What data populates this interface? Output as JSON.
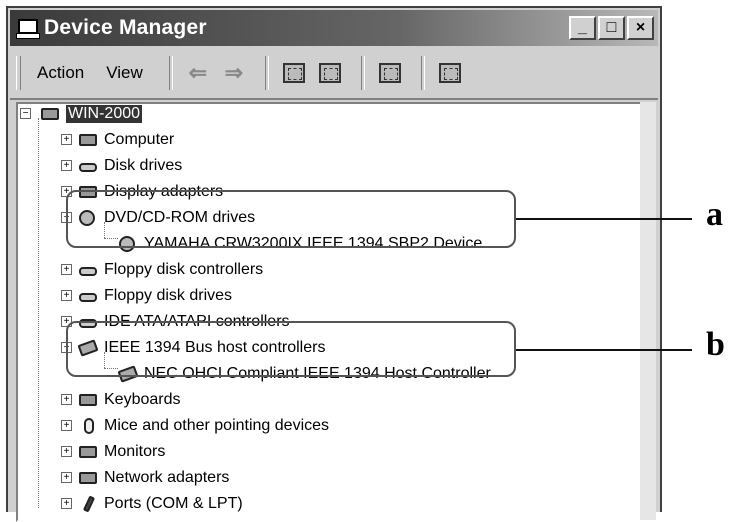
{
  "window": {
    "title": "Device Manager",
    "buttons": {
      "minimize": "_",
      "maximize": "□",
      "close": "×"
    }
  },
  "toolbar": {
    "menu_action": "Action",
    "menu_view": "View",
    "back_icon": "arrow-left-icon",
    "forward_icon": "arrow-right-icon"
  },
  "tree": {
    "root": "WIN-2000",
    "items": [
      {
        "label": "Computer",
        "icon": "computer-icon"
      },
      {
        "label": "Disk drives",
        "icon": "disk-drive-icon"
      },
      {
        "label": "Display adapters",
        "icon": "display-icon"
      },
      {
        "label": "DVD/CD-ROM drives",
        "icon": "dvd-icon",
        "child": "YAMAHA CRW3200IX IEEE 1394 SBP2 Device"
      },
      {
        "label": "Floppy disk controllers",
        "icon": "floppy-controller-icon"
      },
      {
        "label": "Floppy disk drives",
        "icon": "floppy-drive-icon"
      },
      {
        "label": "IDE ATA/ATAPI controllers",
        "icon": "ide-icon"
      },
      {
        "label": "IEEE 1394 Bus host controllers",
        "icon": "ieee1394-icon",
        "child": "NEC OHCI Compliant IEEE 1394 Host Controller"
      },
      {
        "label": "Keyboards",
        "icon": "keyboard-icon"
      },
      {
        "label": "Mice and other pointing devices",
        "icon": "mouse-icon"
      },
      {
        "label": "Monitors",
        "icon": "monitor-icon"
      },
      {
        "label": "Network adapters",
        "icon": "network-adapter-icon"
      },
      {
        "label": "Ports (COM & LPT)",
        "icon": "port-icon"
      }
    ]
  },
  "callouts": {
    "a": "a",
    "b": "b"
  }
}
